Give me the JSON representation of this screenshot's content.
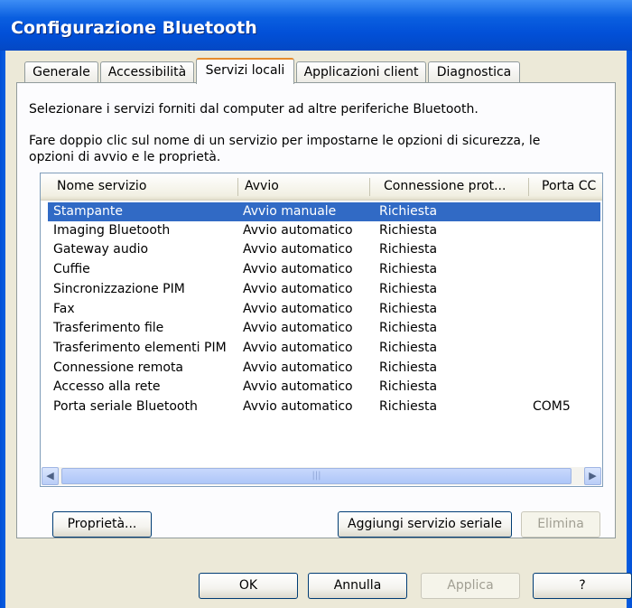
{
  "window": {
    "title": "Configurazione Bluetooth"
  },
  "tabs": [
    {
      "label": "Generale"
    },
    {
      "label": "Accessibilità"
    },
    {
      "label": "Servizi locali",
      "active": true
    },
    {
      "label": "Applicazioni client"
    },
    {
      "label": "Diagnostica"
    }
  ],
  "panel": {
    "description_1": "Selezionare i servizi forniti dal computer ad altre periferiche Bluetooth.",
    "description_2_line1": "Fare doppio clic sul nome di un servizio per impostarne le opzioni di sicurezza, le",
    "description_2_line2": "opzioni di avvio e le proprietà."
  },
  "table": {
    "columns": [
      "Nome servizio",
      "Avvio",
      "Connessione prot...",
      "Porta CC"
    ],
    "rows": [
      {
        "name": "Stampante",
        "avvio": "Avvio manuale",
        "connessione": "Richiesta",
        "porta": "",
        "selected": true
      },
      {
        "name": "Imaging Bluetooth",
        "avvio": "Avvio automatico",
        "connessione": "Richiesta",
        "porta": ""
      },
      {
        "name": "Gateway audio",
        "avvio": "Avvio automatico",
        "connessione": "Richiesta",
        "porta": ""
      },
      {
        "name": "Cuffie",
        "avvio": "Avvio automatico",
        "connessione": "Richiesta",
        "porta": ""
      },
      {
        "name": "Sincronizzazione PIM",
        "avvio": "Avvio automatico",
        "connessione": "Richiesta",
        "porta": ""
      },
      {
        "name": "Fax",
        "avvio": "Avvio automatico",
        "connessione": "Richiesta",
        "porta": ""
      },
      {
        "name": "Trasferimento file",
        "avvio": "Avvio automatico",
        "connessione": "Richiesta",
        "porta": ""
      },
      {
        "name": "Trasferimento elementi PIM",
        "avvio": "Avvio automatico",
        "connessione": "Richiesta",
        "porta": ""
      },
      {
        "name": "Connessione remota",
        "avvio": "Avvio automatico",
        "connessione": "Richiesta",
        "porta": ""
      },
      {
        "name": "Accesso alla rete",
        "avvio": "Avvio automatico",
        "connessione": "Richiesta",
        "porta": ""
      },
      {
        "name": "Porta seriale Bluetooth",
        "avvio": "Avvio automatico",
        "connessione": "Richiesta",
        "porta": "COM5"
      }
    ]
  },
  "buttons": {
    "proprieta": "Proprietà...",
    "aggiungi": "Aggiungi servizio seriale",
    "elimina": "Elimina",
    "ok": "OK",
    "annulla": "Annulla",
    "applica": "Applica",
    "help": "?"
  },
  "icons": {
    "scroll_left": "scroll-left-icon",
    "scroll_right": "scroll-right-icon"
  },
  "colors": {
    "selection": "#316ac5",
    "titlebar": "#0250d8",
    "tab_highlight": "#e68b2c"
  }
}
